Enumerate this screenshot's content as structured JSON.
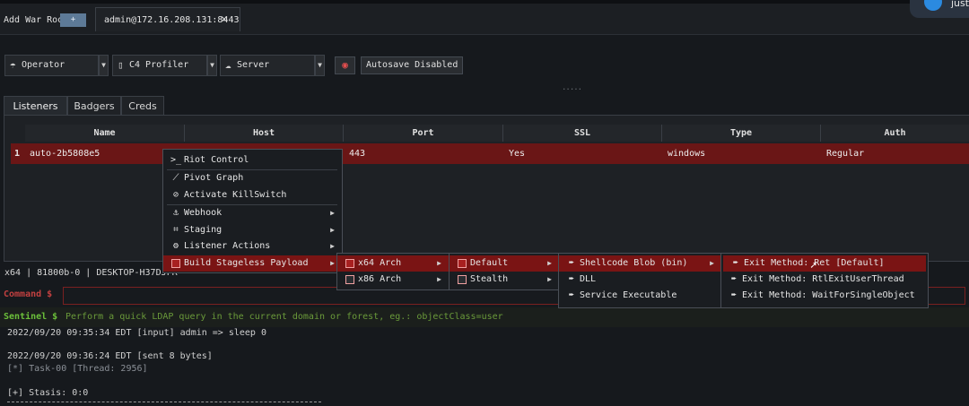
{
  "topbar": {
    "add_war_room": "Add War Room",
    "plus_label": "+",
    "tab_label": "admin@172.16.208.131:8443",
    "tab_close": "✕",
    "notify_text": "just"
  },
  "toolbar": {
    "operator": "Operator",
    "profiler": "C4 Profiler",
    "server": "Server",
    "autosave": "Autosave Disabled",
    "grip": "....."
  },
  "tabs": [
    "Listeners",
    "Badgers",
    "Creds"
  ],
  "table": {
    "headers": [
      "Name",
      "Host",
      "Port",
      "SSL",
      "Type",
      "Auth"
    ],
    "row": {
      "num": "1",
      "name": "auto-2b5808e5",
      "port": "443",
      "ssl": "Yes",
      "type": "windows",
      "auth": "Regular"
    }
  },
  "console": {
    "status": "x64 | 81800b-0 | DESKTOP-H37DJFR",
    "command_label": "Command $",
    "sentinel_label": "Sentinel $",
    "sentinel_hint": "Perform a quick LDAP query in the current domain or forest, eg.: objectClass=user",
    "log": [
      "2022/09/20 09:35:34 EDT [input] admin => sleep 0",
      "2022/09/20 09:36:24 EDT [sent 8 bytes]",
      "[*] Task-00 [Thread: 2956]",
      "[+] Stasis: 0:0"
    ]
  },
  "menus": {
    "main": [
      {
        "icon": "terminal-icon",
        "glyph": ">_",
        "label": "Riot Control"
      },
      {
        "icon": "graph-icon",
        "glyph": "⟋",
        "label": "Pivot Graph"
      },
      {
        "icon": "ban-icon",
        "glyph": "⊘",
        "label": "Activate KillSwitch"
      },
      {
        "icon": "hook-icon",
        "glyph": "⚓",
        "label": "Webhook"
      },
      {
        "icon": "staging-icon",
        "glyph": "⌗",
        "label": "Staging"
      },
      {
        "icon": "gear-icon",
        "glyph": "⚙",
        "label": "Listener Actions"
      },
      {
        "icon": "box-icon",
        "glyph": "",
        "label": "Build Stageless Payload"
      }
    ],
    "arch": [
      "x64 Arch",
      "x86 Arch"
    ],
    "mode": [
      "Default",
      "Stealth"
    ],
    "format": [
      "Shellcode Blob (bin)",
      "DLL",
      "Service Executable"
    ],
    "exit": [
      "Exit Method: Ret [Default]",
      "Exit Method: RtlExitUserThread",
      "Exit Method: WaitForSingleObject"
    ]
  },
  "colors": {
    "row_highlight": "#6a1616",
    "menu_highlight": "#7a1414",
    "command_label": "#c24040",
    "sentinel_label": "#6bbf3a",
    "plus_button": "#5d7a97"
  }
}
